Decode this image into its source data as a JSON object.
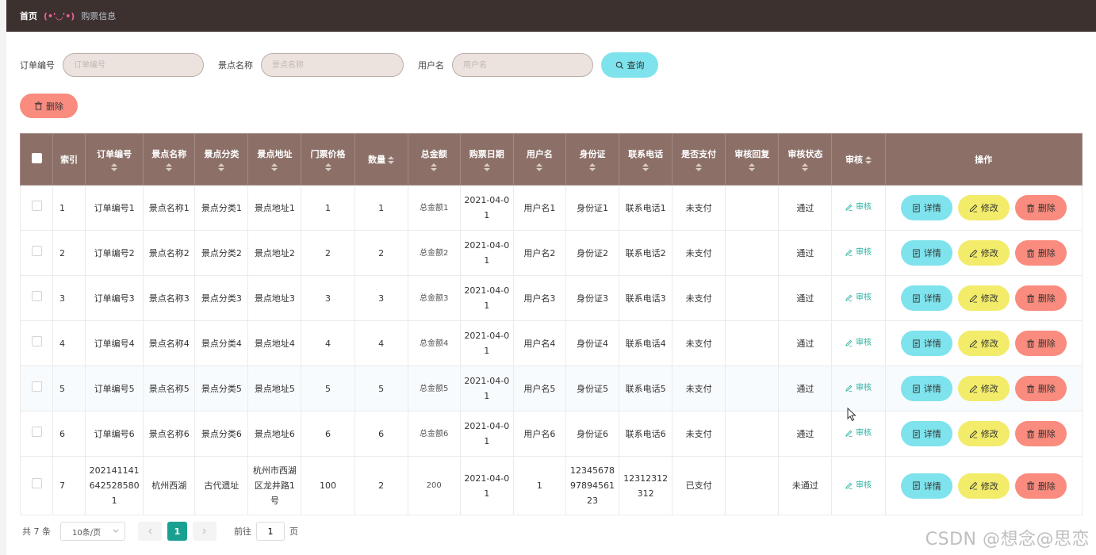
{
  "breadcrumb": {
    "home": "首页",
    "separator": "(•'◡'•)",
    "current": "购票信息"
  },
  "search": {
    "order_label": "订单编号",
    "order_placeholder": "订单编号",
    "spot_label": "景点名称",
    "spot_placeholder": "景点名称",
    "user_label": "用户名",
    "user_placeholder": "用户名",
    "query_button": "查询",
    "query_icon": "search-icon"
  },
  "toolbar": {
    "delete_button": "删除",
    "delete_icon": "trash-icon"
  },
  "table": {
    "columns": [
      "索引",
      "订单编号",
      "景点名称",
      "景点分类",
      "景点地址",
      "门票价格",
      "数量",
      "总金额",
      "购票日期",
      "用户名",
      "身份证",
      "联系电话",
      "是否支付",
      "审核回复",
      "审核状态",
      "审核",
      "操作"
    ],
    "audit_link": "审核",
    "actions": {
      "detail": "详情",
      "edit": "修改",
      "delete": "删除"
    },
    "rows": [
      {
        "index": "1",
        "order_no": "订单编号1",
        "spot_name": "景点名称1",
        "category": "景点分类1",
        "address": "景点地址1",
        "price": "1",
        "quantity": "1",
        "total": "总金额1",
        "date": "2021-04-01",
        "username": "用户名1",
        "id_card": "身份证1",
        "phone": "联系电话1",
        "paid": "未支付",
        "reply": "",
        "status": "通过"
      },
      {
        "index": "2",
        "order_no": "订单编号2",
        "spot_name": "景点名称2",
        "category": "景点分类2",
        "address": "景点地址2",
        "price": "2",
        "quantity": "2",
        "total": "总金额2",
        "date": "2021-04-01",
        "username": "用户名2",
        "id_card": "身份证2",
        "phone": "联系电话2",
        "paid": "未支付",
        "reply": "",
        "status": "通过"
      },
      {
        "index": "3",
        "order_no": "订单编号3",
        "spot_name": "景点名称3",
        "category": "景点分类3",
        "address": "景点地址3",
        "price": "3",
        "quantity": "3",
        "total": "总金额3",
        "date": "2021-04-01",
        "username": "用户名3",
        "id_card": "身份证3",
        "phone": "联系电话3",
        "paid": "未支付",
        "reply": "",
        "status": "通过"
      },
      {
        "index": "4",
        "order_no": "订单编号4",
        "spot_name": "景点名称4",
        "category": "景点分类4",
        "address": "景点地址4",
        "price": "4",
        "quantity": "4",
        "total": "总金额4",
        "date": "2021-04-01",
        "username": "用户名4",
        "id_card": "身份证4",
        "phone": "联系电话4",
        "paid": "未支付",
        "reply": "",
        "status": "通过"
      },
      {
        "index": "5",
        "order_no": "订单编号5",
        "spot_name": "景点名称5",
        "category": "景点分类5",
        "address": "景点地址5",
        "price": "5",
        "quantity": "5",
        "total": "总金额5",
        "date": "2021-04-01",
        "username": "用户名5",
        "id_card": "身份证5",
        "phone": "联系电话5",
        "paid": "未支付",
        "reply": "",
        "status": "通过"
      },
      {
        "index": "6",
        "order_no": "订单编号6",
        "spot_name": "景点名称6",
        "category": "景点分类6",
        "address": "景点地址6",
        "price": "6",
        "quantity": "6",
        "total": "总金额6",
        "date": "2021-04-01",
        "username": "用户名6",
        "id_card": "身份证6",
        "phone": "联系电话6",
        "paid": "未支付",
        "reply": "",
        "status": "通过"
      },
      {
        "index": "7",
        "order_no": "2021411416425285801",
        "spot_name": "杭州西湖",
        "category": "古代遗址",
        "address": "杭州市西湖区龙井路1号",
        "price": "100",
        "quantity": "2",
        "total": "200",
        "date": "2021-04-01",
        "username": "1",
        "id_card": "123456789789456123",
        "phone": "12312312312",
        "paid": "已支付",
        "reply": "",
        "status": "未通过"
      }
    ]
  },
  "pagination": {
    "total": "共 7 条",
    "page_size": "10条/页",
    "current_page": "1",
    "goto_label": "前往",
    "goto_value": "1",
    "page_suffix": "页"
  },
  "watermark": "CSDN @想念@思恋",
  "colors": {
    "header_bg": "#3d3130",
    "table_header": "#8c7068",
    "cyan": "#7ee3ec",
    "yellow": "#f2ec6a",
    "salmon": "#f98c7e",
    "active_page": "#1aa090",
    "audit_link": "#2bb0a0"
  }
}
